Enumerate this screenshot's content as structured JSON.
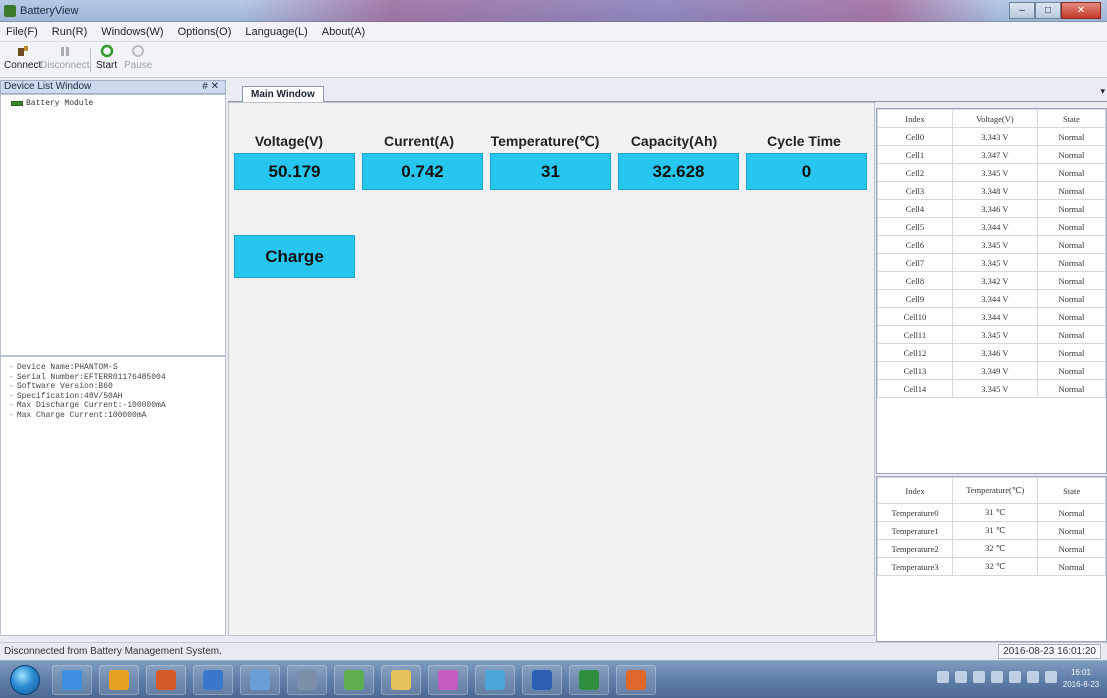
{
  "window": {
    "title": "BatteryView",
    "minimize": "–",
    "maximize": "□",
    "close": "✕"
  },
  "menu": [
    "File(F)",
    "Run(R)",
    "Windows(W)",
    "Options(O)",
    "Language(L)",
    "About(A)"
  ],
  "toolbar": {
    "connect": "Connect",
    "disconnect": "Disconnect",
    "start": "Start",
    "pause": "Pause"
  },
  "device_list": {
    "title": "Device List Window",
    "pin": "# ✕",
    "tree_item": "Battery Module"
  },
  "device_info": [
    "Device Name:PHANTOM-S",
    "Serial Number:EFTERR01176485004",
    "Software Version:B60",
    "Specification:48V/50AH",
    "Max Discharge Current:-100000mA",
    "Max Charge Current:100000mA"
  ],
  "tab": {
    "label": "Main Window",
    "dropdown": "▾"
  },
  "metrics": [
    {
      "label": "Voltage(V)",
      "value": "50.179"
    },
    {
      "label": "Current(A)",
      "value": "0.742"
    },
    {
      "label": "Temperature(℃)",
      "value": "31"
    },
    {
      "label": "Capacity(Ah)",
      "value": "32.628"
    },
    {
      "label": "Cycle Time",
      "value": "0"
    }
  ],
  "state_label": "Charge",
  "cell_table": {
    "headers": [
      "Index",
      "Voltage(V)",
      "State"
    ],
    "rows": [
      [
        "Cell0",
        "3.343 V",
        "Normal"
      ],
      [
        "Cell1",
        "3.347 V",
        "Normal"
      ],
      [
        "Cell2",
        "3.345 V",
        "Normal"
      ],
      [
        "Cell3",
        "3.348 V",
        "Normal"
      ],
      [
        "Cell4",
        "3.346 V",
        "Normal"
      ],
      [
        "Cell5",
        "3.344 V",
        "Normal"
      ],
      [
        "Cell6",
        "3.345 V",
        "Normal"
      ],
      [
        "Cell7",
        "3.345 V",
        "Normal"
      ],
      [
        "Cell8",
        "3.342 V",
        "Normal"
      ],
      [
        "Cell9",
        "3.344 V",
        "Normal"
      ],
      [
        "Cell10",
        "3.344 V",
        "Normal"
      ],
      [
        "Cell11",
        "3.345 V",
        "Normal"
      ],
      [
        "Cell12",
        "3.346 V",
        "Normal"
      ],
      [
        "Cell13",
        "3.349 V",
        "Normal"
      ],
      [
        "Cell14",
        "3.345 V",
        "Normal"
      ]
    ]
  },
  "temp_table": {
    "headers": [
      "Index",
      "Temperature(℃)",
      "State"
    ],
    "rows": [
      [
        "Temperature0",
        "31 ℃",
        "Normal"
      ],
      [
        "Temperature1",
        "31 ℃",
        "Normal"
      ],
      [
        "Temperature2",
        "32 ℃",
        "Normal"
      ],
      [
        "Temperature3",
        "32 ℃",
        "Normal"
      ]
    ]
  },
  "status": {
    "message": "Disconnected from Battery Management System.",
    "datetime": "2016-08-23 16:01:20"
  },
  "taskbar": {
    "clock_time": "16:01",
    "clock_date": "2016-8-23",
    "apps": [
      "ie-icon",
      "media-player-icon",
      "app-icon",
      "skype-icon",
      "app-icon",
      "winrar-icon",
      "tools-icon",
      "folder-icon",
      "settings-icon",
      "app-icon",
      "word-icon",
      "excel-icon",
      "app-icon"
    ]
  },
  "colors": {
    "metric_box": "#27c6ee",
    "taskbar": "#5f7ea8"
  }
}
